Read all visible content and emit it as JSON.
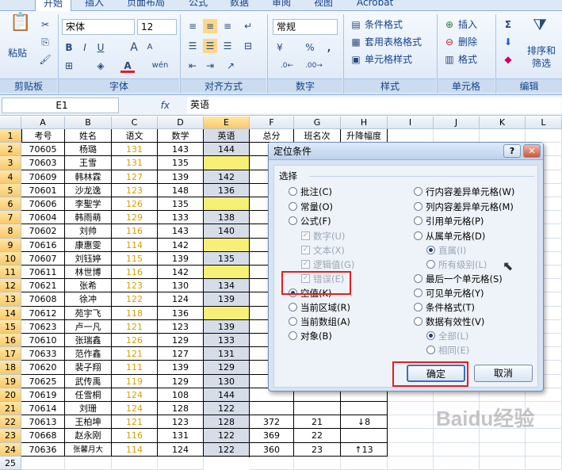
{
  "tabs": [
    "开始",
    "插入",
    "页面布局",
    "公式",
    "数据",
    "审阅",
    "视图",
    "Acrobat"
  ],
  "ribbon": {
    "paste": "粘贴",
    "clipboard": "剪贴板",
    "font_name": "宋体",
    "font_size": "12",
    "font_group": "字体",
    "align_group": "对齐方式",
    "num_format": "常规",
    "num_group": "数字",
    "cond_format": "条件格式",
    "table_format": "套用表格格式",
    "cell_style": "单元格样式",
    "style_group": "样式",
    "insert": "插入",
    "delete": "删除",
    "format": "格式",
    "cells_group": "单元格",
    "sort_filter": "排序和筛选",
    "edit_group": "编辑"
  },
  "formula": {
    "name_box": "E1",
    "fx": "fx",
    "content": "英语"
  },
  "columns": [
    "A",
    "B",
    "C",
    "D",
    "E",
    "F",
    "G",
    "H",
    "I",
    "J",
    "K",
    "L"
  ],
  "header_row": [
    "考号",
    "姓名",
    "语文",
    "数学",
    "英语",
    "总分",
    "班名次",
    "升降幅度"
  ],
  "rows": [
    [
      "70605",
      "杨璐",
      "131",
      "143",
      "144",
      "4",
      "",
      ""
    ],
    [
      "70603",
      "王雪",
      "131",
      "135",
      "",
      "4",
      "",
      ""
    ],
    [
      "70609",
      "韩林霖",
      "127",
      "139",
      "142",
      "4",
      "",
      ""
    ],
    [
      "70601",
      "沙龙逸",
      "123",
      "148",
      "136",
      "4",
      "",
      ""
    ],
    [
      "70606",
      "李聖学",
      "126",
      "135",
      "",
      "4",
      "",
      ""
    ],
    [
      "70604",
      "韩雨萌",
      "129",
      "133",
      "138",
      "4",
      "",
      ""
    ],
    [
      "70602",
      "刘帅",
      "116",
      "143",
      "140",
      "4",
      "",
      ""
    ],
    [
      "70616",
      "康惠雯",
      "114",
      "142",
      "",
      "",
      "",
      ""
    ],
    [
      "70607",
      "刘钰婷",
      "115",
      "139",
      "135",
      "",
      "",
      ""
    ],
    [
      "70611",
      "林世博",
      "116",
      "142",
      "",
      "",
      "",
      ""
    ],
    [
      "70621",
      "张希",
      "123",
      "130",
      "134",
      "",
      "",
      ""
    ],
    [
      "70608",
      "徐冲",
      "122",
      "124",
      "139",
      "",
      "",
      ""
    ],
    [
      "70612",
      "苑宇飞",
      "118",
      "136",
      "",
      "",
      "",
      ""
    ],
    [
      "70623",
      "卢一凡",
      "121",
      "123",
      "139",
      "",
      "",
      ""
    ],
    [
      "70610",
      "张瑞鑫",
      "126",
      "129",
      "133",
      "",
      "",
      ""
    ],
    [
      "70633",
      "范作鑫",
      "121",
      "127",
      "131",
      "",
      "",
      ""
    ],
    [
      "70620",
      "裴子翔",
      "111",
      "139",
      "129",
      "",
      "",
      ""
    ],
    [
      "70625",
      "武传禹",
      "119",
      "129",
      "130",
      "",
      "",
      ""
    ],
    [
      "70619",
      "任雪桐",
      "124",
      "108",
      "144",
      "",
      "",
      ""
    ],
    [
      "70614",
      "刘珊",
      "124",
      "128",
      "122",
      "",
      "",
      ""
    ],
    [
      "70613",
      "王柏坤",
      "121",
      "123",
      "128",
      "372",
      "21",
      "↓8"
    ],
    [
      "70668",
      "赵永刚",
      "116",
      "131",
      "122",
      "369",
      "22",
      ""
    ],
    [
      "70636",
      "张馨月大",
      "114",
      "124",
      "122",
      "360",
      "23",
      "↑13"
    ]
  ],
  "dialog": {
    "title": "定位条件",
    "help": "?",
    "close": "✕",
    "section": "选择",
    "left": [
      "批注(C)",
      "常量(O)",
      "公式(F)",
      "数字(U)",
      "文本(X)",
      "逻辑值(G)",
      "错误(E)",
      "空值(K)",
      "当前区域(R)",
      "当前数组(A)",
      "对象(B)"
    ],
    "right": [
      "行内容差异单元格(W)",
      "列内容差异单元格(M)",
      "引用单元格(P)",
      "从属单元格(D)",
      "直属(I)",
      "所有级别(L)",
      "最后一个单元格(S)",
      "可见单元格(Y)",
      "条件格式(T)",
      "数据有效性(V)",
      "全部(L)",
      "相同(E)"
    ],
    "ok": "确定",
    "cancel": "取消"
  },
  "watermark": "Baidu经验"
}
